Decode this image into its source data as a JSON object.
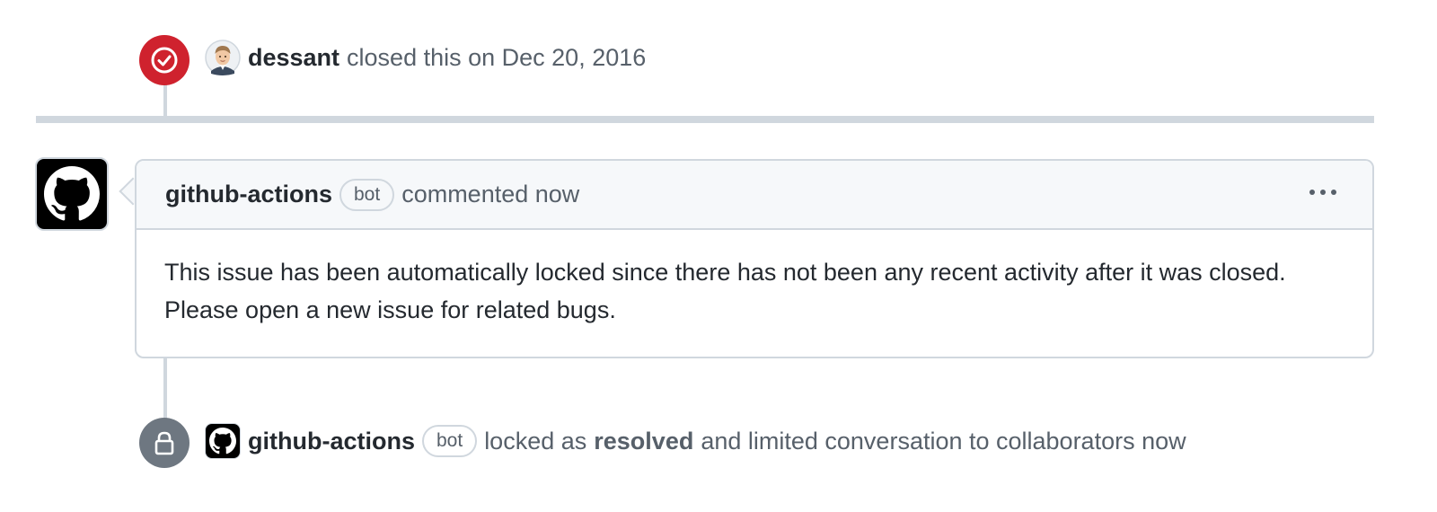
{
  "timeline": {
    "closed_event": {
      "actor": "dessant",
      "action_text": "closed this on Dec 20, 2016",
      "badge_color": "#cf222e",
      "icon": "check-circle-icon"
    },
    "comment": {
      "author": "github-actions",
      "bot_label": "bot",
      "action_text": "commented now",
      "body": [
        "This issue has been automatically locked since there has not been any recent activity after it was closed.",
        "Please open a new issue for related bugs."
      ],
      "menu_icon": "kebab-horizontal-icon"
    },
    "locked_event": {
      "actor": "github-actions",
      "bot_label": "bot",
      "action_prefix": "locked as",
      "reason": "resolved",
      "action_suffix": "and limited conversation to collaborators now",
      "badge_color": "#6e7781",
      "icon": "lock-icon"
    }
  },
  "colors": {
    "border": "#d0d7de",
    "muted_text": "#57606a",
    "primary_text": "#24292f",
    "header_bg": "#f6f8fa"
  }
}
